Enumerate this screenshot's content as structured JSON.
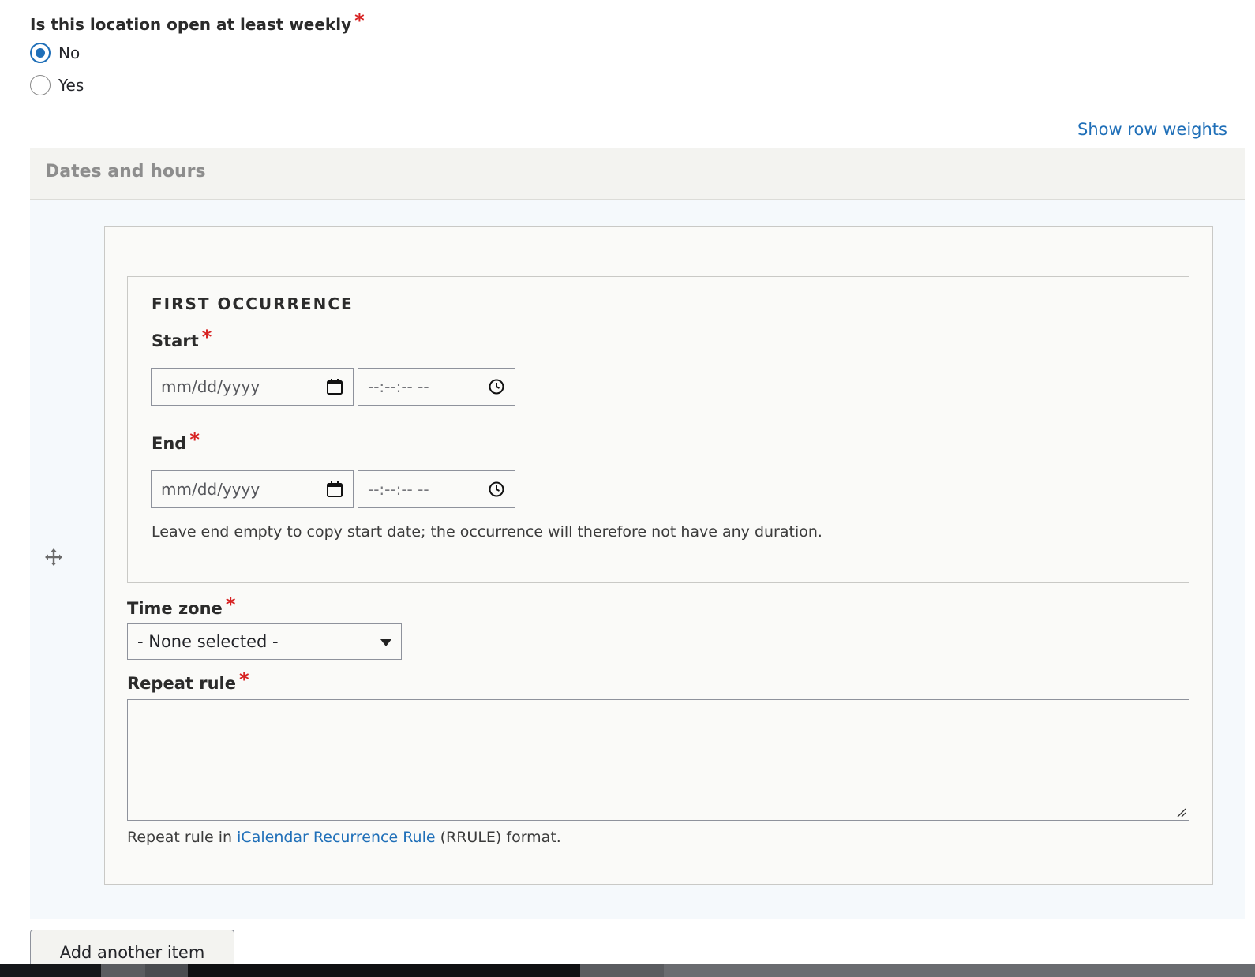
{
  "weekly": {
    "label": "Is this location open at least weekly",
    "required": "*",
    "options": [
      {
        "label": "No",
        "checked": true
      },
      {
        "label": "Yes",
        "checked": false
      }
    ]
  },
  "table": {
    "show_weights_label": "Show row weights",
    "header": "Dates and hours"
  },
  "occurrence": {
    "legend": "FIRST OCCURRENCE",
    "start_label": "Start",
    "end_label": "End",
    "required": "*",
    "date_placeholder": "mm/dd/yyyy",
    "time_placeholder": "--:--:-- --",
    "description": "Leave end empty to copy start date; the occurrence will therefore not have any duration."
  },
  "timezone": {
    "label": "Time zone",
    "required": "*",
    "selected": "- None selected -"
  },
  "repeat_rule": {
    "label": "Repeat rule",
    "required": "*",
    "value": "",
    "desc_prefix": "Repeat rule in ",
    "desc_link": "iCalendar Recurrence Rule",
    "desc_suffix": " (RRULE) format."
  },
  "actions": {
    "add_another": "Add another item"
  },
  "colors": {
    "accent": "#1f6fb8",
    "required": "#d72222"
  }
}
